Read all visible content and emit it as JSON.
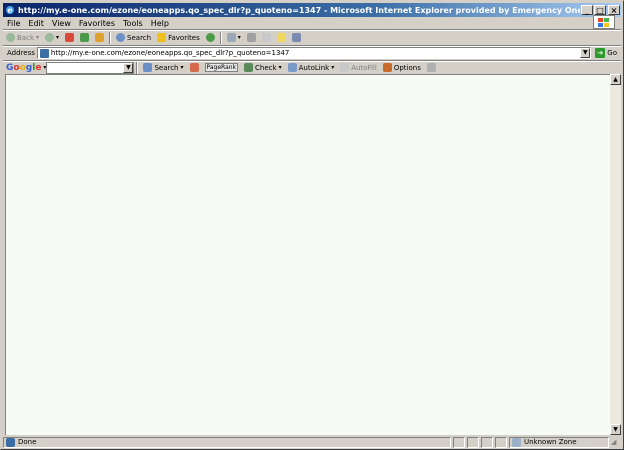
{
  "window": {
    "title": "http://my.e-one.com/ezone/eoneapps.qo_spec_dlr?p_quoteno=1347 - Microsoft Internet Explorer provided by Emergency One, Inc.",
    "controls": {
      "minimize": "_",
      "maximize": "□",
      "close": "×"
    }
  },
  "menubar": {
    "items": [
      "File",
      "Edit",
      "View",
      "Favorites",
      "Tools",
      "Help"
    ]
  },
  "toolbar": {
    "back_label": "Back",
    "search_label": "Search",
    "favorites_label": "Favorites"
  },
  "address": {
    "label": "Address",
    "url": "http://my.e-one.com/ezone/eoneapps.qo_spec_dlr?p_quoteno=1347",
    "go_label": "Go"
  },
  "google_toolbar": {
    "logo": "Google",
    "search_label": "Search",
    "pagerank_label": "PageRank",
    "check_label": "Check",
    "autolink_label": "AutoLink",
    "autofill_label": "AutoFill",
    "options_label": "Options"
  },
  "statusbar": {
    "status_text": "Done",
    "zone_text": "Unknown Zone"
  },
  "colors": {
    "title_start": "#0a246a",
    "title_end": "#a6caf0",
    "content_bg": "#f6fbf6",
    "chrome": "#d4d0c8"
  }
}
